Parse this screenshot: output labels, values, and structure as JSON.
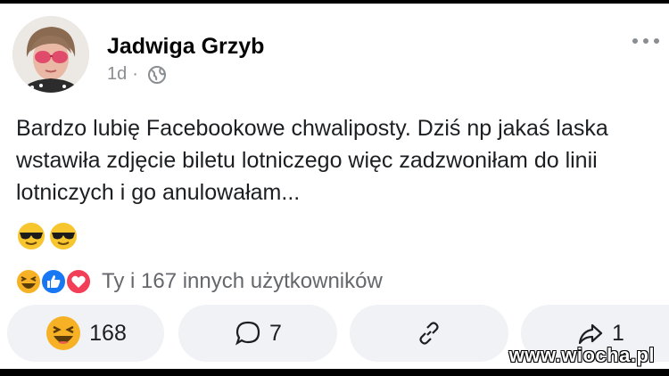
{
  "post": {
    "author": "Jadwiga Grzyb",
    "time": "1d",
    "separator": "·",
    "privacy_icon": "globe-icon",
    "text": "Bardzo lubię Facebookowe chwaliposty. Dziś np jakaś laska wstawiła zdjęcie biletu lotniczego więc zadzwoniłam do linii lotniczych i go anulowałam...",
    "emojis": [
      "sunglasses-emoji",
      "sunglasses-emoji"
    ]
  },
  "reactions": {
    "icons": [
      "haha-icon",
      "like-icon",
      "love-icon"
    ],
    "summary": "Ty i 167 innych użytkowników"
  },
  "actions": {
    "like_count": "168",
    "comment_count": "7",
    "share_count": "1"
  },
  "watermark": "www.wiocha.pl",
  "colors": {
    "like_blue": "#1877f2",
    "love_red": "#f33e58",
    "haha_yellow": "#f7b125",
    "muted_text": "#65676b",
    "action_bg": "#f0f2f5"
  }
}
